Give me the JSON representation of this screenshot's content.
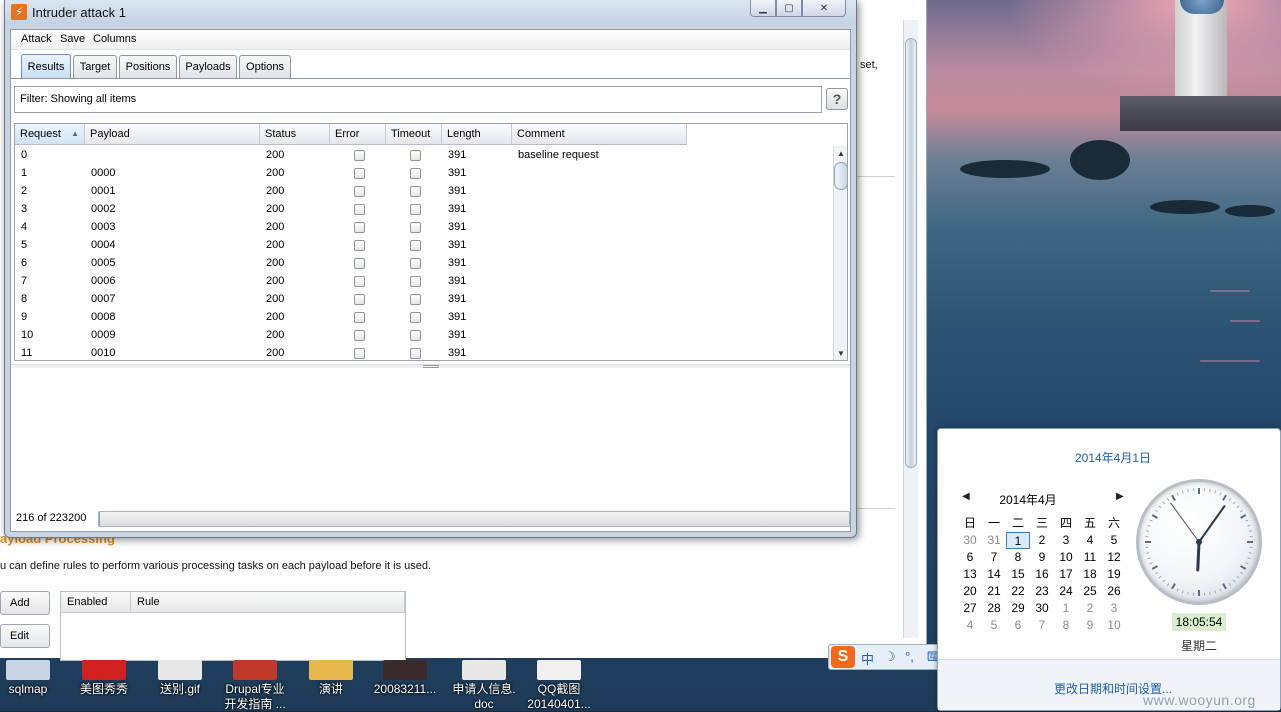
{
  "background_window": {
    "section_title": "ayload Processing",
    "description": "u can define rules to perform various processing tasks on each payload before it is used.",
    "right_text": "set,",
    "add_label": "Add",
    "edit_label": "Edit",
    "col_enabled": "Enabled",
    "col_rule": "Rule"
  },
  "intruder": {
    "title": "Intruder attack 1",
    "icon": "burp-icon",
    "menu": [
      "Attack",
      "Save",
      "Columns"
    ],
    "tabs": [
      "Results",
      "Target",
      "Positions",
      "Payloads",
      "Options"
    ],
    "active_tab": "Results",
    "filter": "Filter:  Showing all items",
    "help_label": "?",
    "columns": [
      "Request",
      "Payload",
      "Status",
      "Error",
      "Timeout",
      "Length",
      "Comment"
    ],
    "rows": [
      {
        "request": "0",
        "payload": "",
        "status": "200",
        "length": "391",
        "comment": "baseline request"
      },
      {
        "request": "1",
        "payload": "0000",
        "status": "200",
        "length": "391",
        "comment": ""
      },
      {
        "request": "2",
        "payload": "0001",
        "status": "200",
        "length": "391",
        "comment": ""
      },
      {
        "request": "3",
        "payload": "0002",
        "status": "200",
        "length": "391",
        "comment": ""
      },
      {
        "request": "4",
        "payload": "0003",
        "status": "200",
        "length": "391",
        "comment": ""
      },
      {
        "request": "5",
        "payload": "0004",
        "status": "200",
        "length": "391",
        "comment": ""
      },
      {
        "request": "6",
        "payload": "0005",
        "status": "200",
        "length": "391",
        "comment": ""
      },
      {
        "request": "7",
        "payload": "0006",
        "status": "200",
        "length": "391",
        "comment": ""
      },
      {
        "request": "8",
        "payload": "0007",
        "status": "200",
        "length": "391",
        "comment": ""
      },
      {
        "request": "9",
        "payload": "0008",
        "status": "200",
        "length": "391",
        "comment": ""
      },
      {
        "request": "10",
        "payload": "0009",
        "status": "200",
        "length": "391",
        "comment": ""
      },
      {
        "request": "11",
        "payload": "0010",
        "status": "200",
        "length": "391",
        "comment": ""
      }
    ],
    "progress_text": "216 of 223200",
    "progress_fraction": 0.001
  },
  "desktop_icons": [
    {
      "label": "sqlmap",
      "label2": ""
    },
    {
      "label": "美图秀秀",
      "label2": ""
    },
    {
      "label": "送别.gif",
      "label2": ""
    },
    {
      "label": "Drupal专业",
      "label2": "开发指南 ..."
    },
    {
      "label": "演讲",
      "label2": ""
    },
    {
      "label": "20083211...",
      "label2": ""
    },
    {
      "label": "申请人信息.",
      "label2": "doc"
    },
    {
      "label": "QQ截图",
      "label2": "20140401..."
    }
  ],
  "ime": {
    "logo": "S",
    "items": [
      "中",
      "☽",
      "°,",
      "⌨",
      "♟",
      "👕",
      "🔧"
    ]
  },
  "calendar": {
    "date_link": "2014年4月1日",
    "month": "2014年4月",
    "weekdays": [
      "日",
      "一",
      "二",
      "三",
      "四",
      "五",
      "六"
    ],
    "weeks": [
      [
        "30",
        "31",
        "1",
        "2",
        "3",
        "4",
        "5"
      ],
      [
        "6",
        "7",
        "8",
        "9",
        "10",
        "11",
        "12"
      ],
      [
        "13",
        "14",
        "15",
        "16",
        "17",
        "18",
        "19"
      ],
      [
        "20",
        "21",
        "22",
        "23",
        "24",
        "25",
        "26"
      ],
      [
        "27",
        "28",
        "29",
        "30",
        "1",
        "2",
        "3"
      ],
      [
        "4",
        "5",
        "6",
        "7",
        "8",
        "9",
        "10"
      ]
    ],
    "time": "18:05:54",
    "day": "星期二",
    "footer_link": "更改日期和时间设置..."
  },
  "watermark": "www.wooyun.org",
  "colors": {
    "accent_orange": "#e58a1f",
    "link_blue": "#1e5fa8",
    "selected_tab": "#c9def5"
  }
}
